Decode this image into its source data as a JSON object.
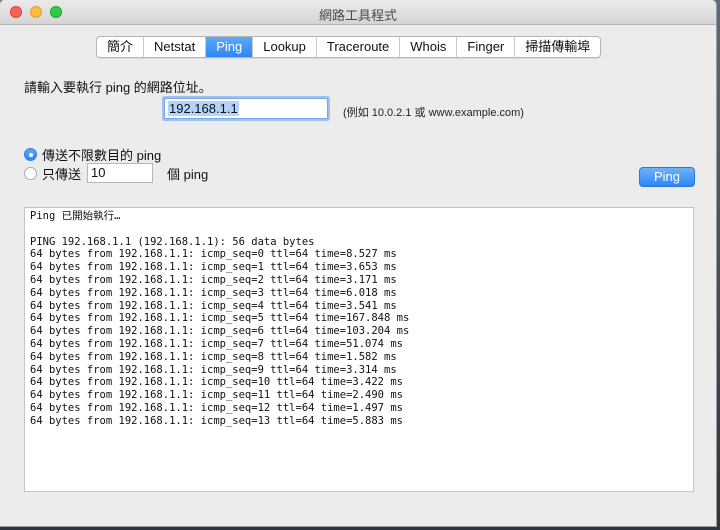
{
  "window": {
    "title": "網路工具程式"
  },
  "tabs": [
    {
      "label": "簡介",
      "active": false
    },
    {
      "label": "Netstat",
      "active": false
    },
    {
      "label": "Ping",
      "active": true
    },
    {
      "label": "Lookup",
      "active": false
    },
    {
      "label": "Traceroute",
      "active": false
    },
    {
      "label": "Whois",
      "active": false
    },
    {
      "label": "Finger",
      "active": false
    },
    {
      "label": "掃描傳輸埠",
      "active": false
    }
  ],
  "ping": {
    "prompt": "請輸入要執行 ping 的網路位址。",
    "address": "192.168.1.1",
    "example": "(例如 10.0.2.1 或 www.example.com)",
    "unlimited_label": "傳送不限數目的 ping",
    "only_label": "只傳送",
    "count_value": "10",
    "count_suffix": "個 ping",
    "button_label": "Ping",
    "selected_mode": "unlimited"
  },
  "output": {
    "lines": [
      "Ping 已開始執行…",
      "",
      "PING 192.168.1.1 (192.168.1.1): 56 data bytes",
      "64 bytes from 192.168.1.1: icmp_seq=0 ttl=64 time=8.527 ms",
      "64 bytes from 192.168.1.1: icmp_seq=1 ttl=64 time=3.653 ms",
      "64 bytes from 192.168.1.1: icmp_seq=2 ttl=64 time=3.171 ms",
      "64 bytes from 192.168.1.1: icmp_seq=3 ttl=64 time=6.018 ms",
      "64 bytes from 192.168.1.1: icmp_seq=4 ttl=64 time=3.541 ms",
      "64 bytes from 192.168.1.1: icmp_seq=5 ttl=64 time=167.848 ms",
      "64 bytes from 192.168.1.1: icmp_seq=6 ttl=64 time=103.204 ms",
      "64 bytes from 192.168.1.1: icmp_seq=7 ttl=64 time=51.074 ms",
      "64 bytes from 192.168.1.1: icmp_seq=8 ttl=64 time=1.582 ms",
      "64 bytes from 192.168.1.1: icmp_seq=9 ttl=64 time=3.314 ms",
      "64 bytes from 192.168.1.1: icmp_seq=10 ttl=64 time=3.422 ms",
      "64 bytes from 192.168.1.1: icmp_seq=11 ttl=64 time=2.490 ms",
      "64 bytes from 192.168.1.1: icmp_seq=12 ttl=64 time=1.497 ms",
      "64 bytes from 192.168.1.1: icmp_seq=13 ttl=64 time=5.883 ms"
    ]
  },
  "colors": {
    "accent": "#2f87f5",
    "window_bg": "#ececec",
    "close": "#fc605c",
    "minimize": "#fdbc40",
    "maximize": "#34c84a"
  }
}
